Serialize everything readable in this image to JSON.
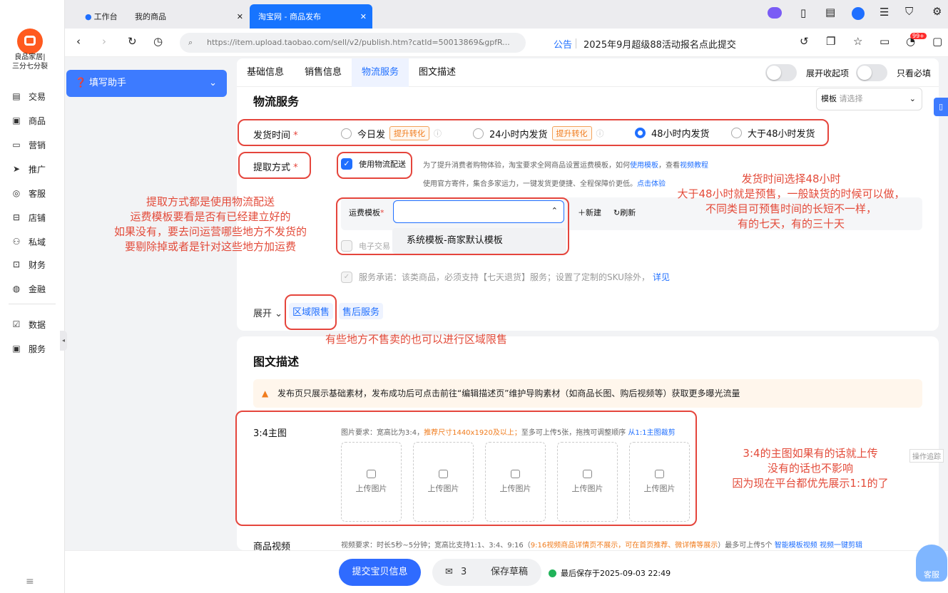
{
  "tabs": [
    {
      "label": "工作台"
    },
    {
      "label": "我的商品"
    },
    {
      "label": "淘宝网 - 商品发布"
    }
  ],
  "url": "https://item.upload.taobao.com/sell/v2/publish.htm?catId=50013869&gpfR...",
  "notice": {
    "label": "公告",
    "text": "2025年9月超级88活动报名点此提交"
  },
  "badge": "99+",
  "store": {
    "line1": "良品家居|",
    "line2": "三分七分裂"
  },
  "nav": [
    {
      "label": "交易",
      "icon": "document-icon"
    },
    {
      "label": "商品",
      "icon": "box-icon"
    },
    {
      "label": "营销",
      "icon": "ticket-icon"
    },
    {
      "label": "推广",
      "icon": "send-icon"
    },
    {
      "label": "客服",
      "icon": "headset-icon"
    },
    {
      "label": "店铺",
      "icon": "store-icon"
    },
    {
      "label": "私域",
      "icon": "people-icon"
    },
    {
      "label": "财务",
      "icon": "finance-icon"
    },
    {
      "label": "金融",
      "icon": "money-icon"
    },
    {
      "label": "数据",
      "icon": "chart-icon"
    },
    {
      "label": "服务",
      "icon": "service-icon"
    }
  ],
  "assistant": "填写助手",
  "subtabs": [
    "基础信息",
    "销售信息",
    "物流服务",
    "图文描述"
  ],
  "expand_toggle": "展开收起项",
  "required_toggle": "只看必填",
  "logistics": {
    "title": "物流服务",
    "template_label": "模板",
    "template_placeholder": "请选择",
    "ship_time_label": "发货时间",
    "required_mark": "*",
    "ship_options": [
      {
        "label": "今日发",
        "tag": "提升转化",
        "selected": false
      },
      {
        "label": "24小时内发货",
        "tag": "提升转化",
        "selected": false
      },
      {
        "label": "48小时内发货",
        "tag": "",
        "selected": true
      },
      {
        "label": "大于48小时发货",
        "tag": "",
        "selected": false
      }
    ],
    "pickup_label": "提取方式",
    "pickup_option": "使用物流配送",
    "pickup_desc1_a": "为了提升消费者购物体验，淘宝要求全网商品设置运费模板，如何",
    "pickup_desc1_link1": "使用模板",
    "pickup_desc1_b": "，查看",
    "pickup_desc1_link2": "视频教程",
    "pickup_desc2": "使用官方寄件，集合多家运力，一键发货更便捷、全程保障价更低。",
    "pickup_desc2_link": "点击体验",
    "freight_label": "运费模板",
    "freight_new": "新建",
    "freight_refresh": "刷新",
    "freight_option": "系统模板-商家默认模板",
    "ecommerce": "电子交易",
    "service_promise": "服务承诺：该类商品，必须支持【七天退货】服务；设置了定制的SKU除外，",
    "service_more": "详见",
    "expand": "展开",
    "region": "区域限售",
    "aftersale": "售后服务"
  },
  "desc": {
    "title": "图文描述",
    "warning": "发布页只展示基础素材，发布成功后可点击前往“编辑描述页”维护导购素材（如商品长图、购后视频等）获取更多曝光流量",
    "main_img_label": "3:4主图",
    "img_req_a": "图片要求：宽高比为3:4，",
    "img_req_orange": "推荐尺寸1440x1920及以上；",
    "img_req_b": "至多可上传5张，拖拽可调整顺序",
    "img_req_link": "从1:1主图裁剪",
    "upload_label": "上传图片",
    "upload_count": 5,
    "video_label": "商品视频",
    "video_req_a": "视频要求：时长5秒~5分钟；宽高比支持1:1、3:4、9:16（",
    "video_req_orange": "9:16视频商品详情页不展示，可在首页推荐、微详情等展示",
    "video_req_b": "）最多可上传5个",
    "video_link1": "智能模板视频",
    "video_link2": "视频一键剪辑"
  },
  "annotations": {
    "a1": [
      "提取方式都是使用物流配送",
      "运费模板要看是否有已经建立好的",
      "如果没有，要去问运营哪些地方不发货的",
      "要剔除掉或者是针对这些地方加运费"
    ],
    "a2": [
      "发货时间选择48小时",
      "大于48小时就是预售，一般缺货的时候可以做，",
      "不同类目可预售时间的长短不一样，",
      "有的七天，有的三十天"
    ],
    "a3": "有些地方不售卖的也可以进行区域限售",
    "a4": [
      "3:4的主图如果有的话就上传",
      "没有的话也不影响",
      "因为现在平台都优先展示1:1的了"
    ]
  },
  "op_trace": "操作追踪",
  "bottom": {
    "submit": "提交宝贝信息",
    "mail_count": "3",
    "save_draft": "保存草稿",
    "saved_at": "最后保存于2025-09-03 22:49",
    "kefu": "客服"
  },
  "colors": {
    "primary": "#1f6fff",
    "annotation": "#e5453c",
    "brand": "#ff5a1f"
  }
}
